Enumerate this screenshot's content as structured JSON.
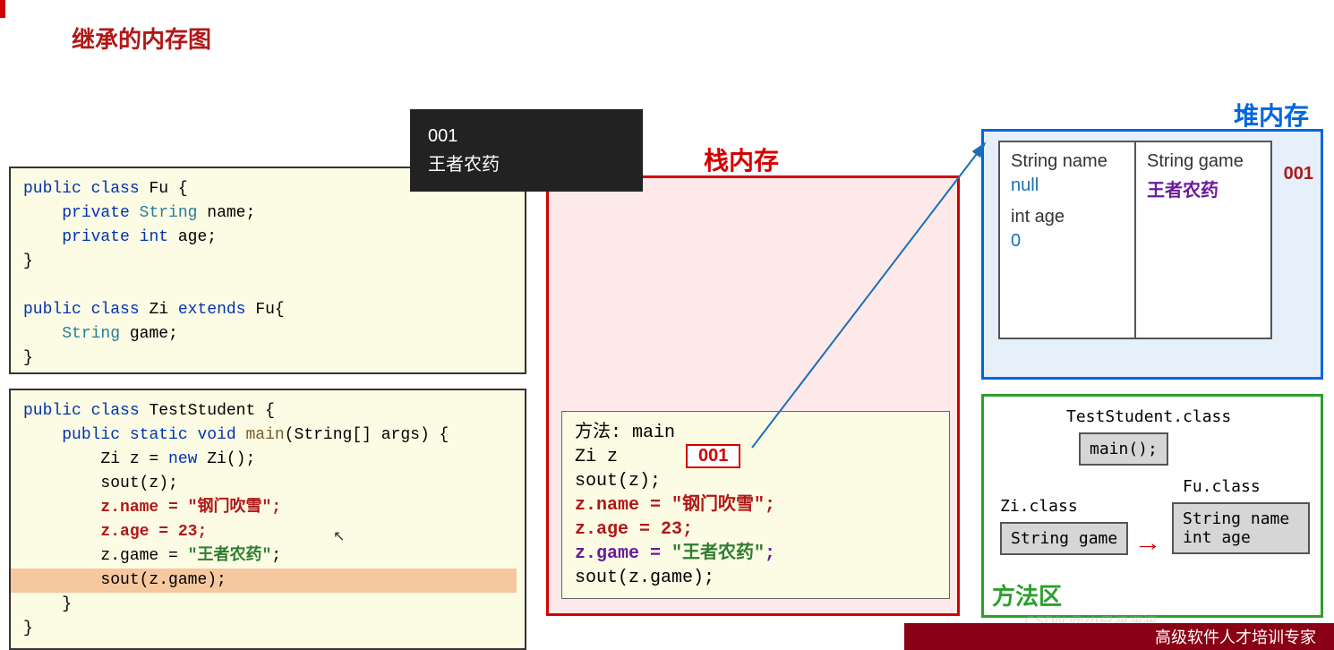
{
  "title": "继承的内存图",
  "tooltip": {
    "line1": "001",
    "line2": "王者农药"
  },
  "sections": {
    "stack": "栈内存",
    "heap": "堆内存",
    "methodArea": "方法区"
  },
  "code_fu": {
    "l1a": "public",
    "l1b": "class",
    "l1c": "Fu",
    "l1d": "{",
    "l2a": "private",
    "l2b": "String",
    "l2c": "name;",
    "l3a": "private",
    "l3b": "int",
    "l3c": "age;",
    "l4": "}",
    "l5a": "public",
    "l5b": "class",
    "l5c": "Zi",
    "l5d": "extends",
    "l5e": "Fu{",
    "l6a": "String",
    "l6b": "game;",
    "l7": "}"
  },
  "code_test": {
    "l1a": "public",
    "l1b": "class",
    "l1c": "TestStudent",
    "l1d": "{",
    "l2a": "public",
    "l2b": "static",
    "l2c": "void",
    "l2d": "main",
    "l2e": "(String[] args) {",
    "l3": "Zi z = ",
    "l3b": "new",
    "l3c": " Zi();",
    "l4": "sout(z);",
    "l5": "z.name = \"钢门吹雪\";",
    "l6": "z.age = 23;",
    "l7a": "z.game = ",
    "l7b": "\"王者农药\"",
    "l7c": ";",
    "l8": "sout(z.game);",
    "l9": "}",
    "l10": "}"
  },
  "stack_frame": {
    "l1": "方法: main",
    "l2": "Zi z",
    "addr": "001",
    "l3": "sout(z);",
    "l4": "z.name = \"钢门吹雪\";",
    "l5": "z.age = 23;",
    "l6a": "z.game = ",
    "l6b": "\"王者农药\"",
    "l6c": ";",
    "l7": "sout(z.game);"
  },
  "heap_obj": {
    "addr": "001",
    "left": {
      "f1": "String name",
      "v1": "null",
      "f2": "int age",
      "v2": "0"
    },
    "right": {
      "f1": "String game",
      "v1": "王者农药"
    }
  },
  "method_area": {
    "ts_label": "TestStudent.class",
    "ts_cell": "main();",
    "zi_label": "Zi.class",
    "zi_cell": "String game",
    "fu_label": "Fu.class",
    "fu_cell_1": "String name",
    "fu_cell_2": "int age"
  },
  "footer": "高级软件人才培训专家",
  "watermark": "CSDN @小白冲冲冲"
}
